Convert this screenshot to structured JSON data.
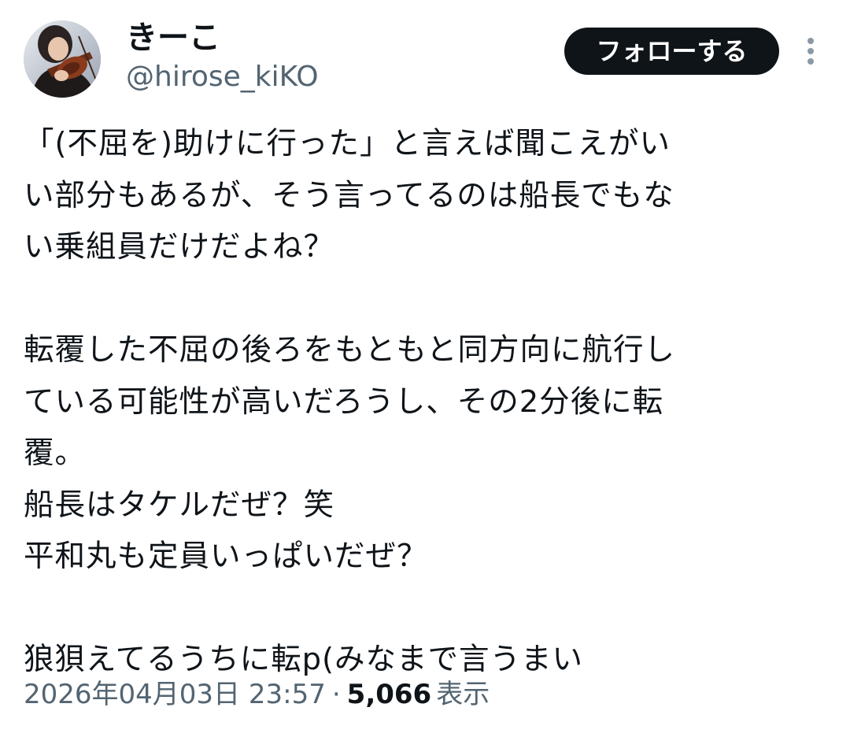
{
  "author": {
    "display_name": "きーこ",
    "handle": "@hirose_kiKO",
    "avatar_icon": "avatar-violinist-photo"
  },
  "actions": {
    "follow_label": "フォローする",
    "more_icon": "more-vertical-icon"
  },
  "tweet": {
    "lines": [
      "「(不屈を)助けに行った」と言えば聞こえがい",
      "い部分もあるが、そう言ってるのは船長でもな",
      "い乗組員だけだよね？",
      "",
      "転覆した不屈の後ろをもともと同方向に航行し",
      "ている可能性が高いだろうし、その2分後に転",
      "覆。",
      "船長はタケルだぜ？笑",
      "平和丸も定員いっぱいだぜ？",
      "",
      "狼狽えてるうちに転p(みなまで言うまい"
    ]
  },
  "meta": {
    "timestamp": "2026年04月03日 23:57",
    "separator": "·",
    "view_count": "5,066",
    "view_label": "表示"
  },
  "colors": {
    "text_primary": "#0f1419",
    "text_secondary": "#536471",
    "button_bg": "#0f1419",
    "button_text": "#ffffff",
    "background": "#ffffff"
  }
}
